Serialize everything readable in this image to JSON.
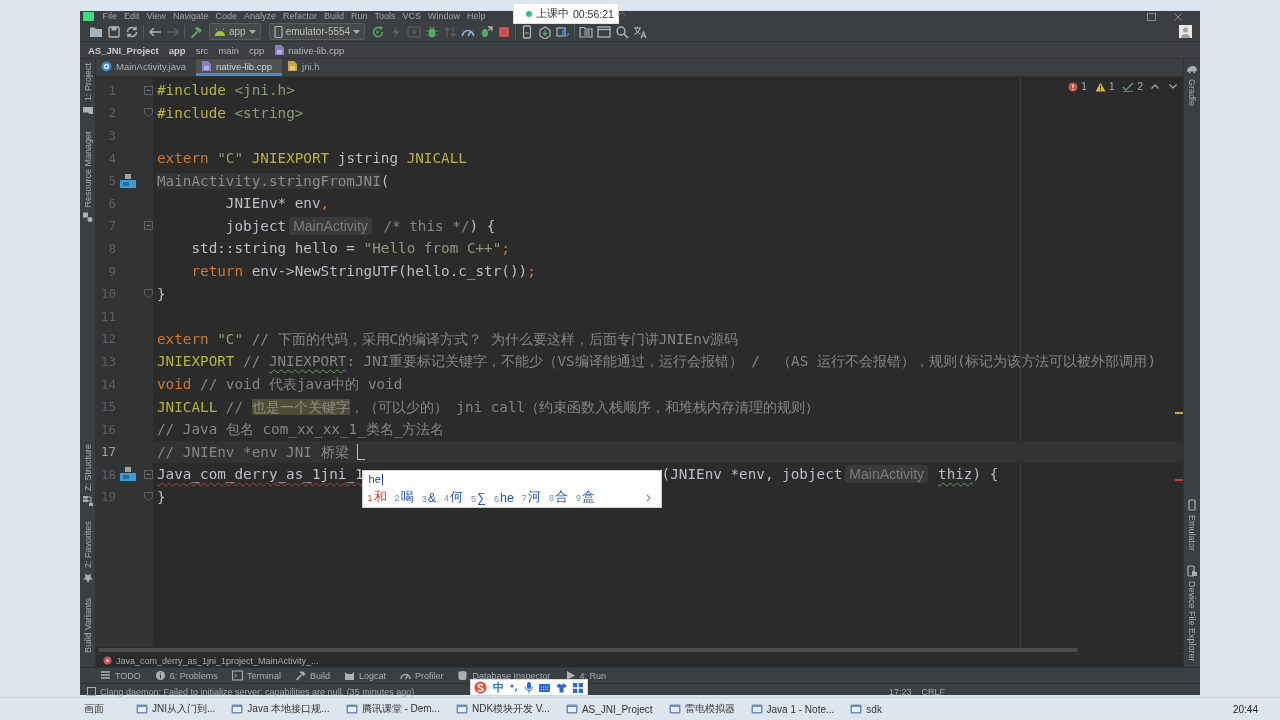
{
  "window": {
    "menu": [
      "File",
      "Edit",
      "View",
      "Navigate",
      "Code",
      "Analyze",
      "Refactor",
      "Build",
      "Run",
      "Tools",
      "VCS",
      "Window",
      "Help"
    ]
  },
  "recording_badge": {
    "label": "上课中",
    "time": "00:56:21"
  },
  "toolbar": {
    "groups": [
      [
        {
          "kind": "open",
          "disabled": false
        },
        {
          "kind": "save",
          "disabled": false
        },
        {
          "kind": "sync",
          "disabled": false
        }
      ],
      [
        {
          "kind": "back",
          "disabled": false
        },
        {
          "kind": "forward",
          "disabled": true
        }
      ],
      [
        {
          "kind": "build",
          "disabled": false
        },
        {
          "kind": "run_config",
          "label": "app"
        },
        {
          "kind": "device",
          "label": "emulator-5554"
        },
        {
          "kind": "rerun",
          "disabled": false
        },
        {
          "kind": "apply_changes",
          "disabled": true
        },
        {
          "kind": "apply_code",
          "disabled": true
        },
        {
          "kind": "debug",
          "disabled": false
        },
        {
          "kind": "attach",
          "disabled": true
        },
        {
          "kind": "profile",
          "disabled": false
        },
        {
          "kind": "attach_debugger",
          "disabled": false
        },
        {
          "kind": "stop",
          "disabled": false
        }
      ],
      [
        {
          "kind": "avd",
          "disabled": false
        },
        {
          "kind": "sdk",
          "disabled": false
        },
        {
          "kind": "gradle_sync",
          "disabled": false
        }
      ],
      [
        {
          "kind": "structure",
          "disabled": false
        },
        {
          "kind": "window",
          "disabled": false
        },
        {
          "kind": "search",
          "disabled": false
        },
        {
          "kind": "translate",
          "disabled": false
        }
      ]
    ]
  },
  "nav_bar": {
    "crumbs": [
      {
        "label": "AS_JNI_Project",
        "kind": "project"
      },
      {
        "label": "app",
        "kind": "module"
      },
      {
        "label": "src",
        "kind": "dir"
      },
      {
        "label": "main",
        "kind": "dir"
      },
      {
        "label": "cpp",
        "kind": "dir"
      },
      {
        "label": "native-lib.cpp",
        "kind": "cpp"
      }
    ]
  },
  "tabs": [
    {
      "label": "MainActivity.java",
      "kind": "java",
      "selected": false
    },
    {
      "label": "native-lib.cpp",
      "kind": "cpp",
      "selected": true
    },
    {
      "label": "jni.h",
      "kind": "header",
      "selected": false
    }
  ],
  "left_tool_strip": {
    "top": [
      {
        "label": "1: Project",
        "kind": "project"
      },
      {
        "label": "Resource Manager",
        "kind": "resources"
      }
    ],
    "bottom": [
      {
        "label": "Z: Structure",
        "kind": "structure"
      },
      {
        "label": "2: Favorites",
        "kind": "favorites"
      },
      {
        "label": "Build Variants",
        "kind": "variants"
      }
    ]
  },
  "right_tool_strip": {
    "top": [
      {
        "label": "Gradle",
        "kind": "gradle"
      }
    ],
    "bottom": [
      {
        "label": "Emulator",
        "kind": "emulator"
      },
      {
        "label": "Device File Explorer",
        "kind": "device_files"
      }
    ]
  },
  "editor": {
    "inspections": [
      {
        "kind": "error",
        "count": "1"
      },
      {
        "kind": "warning",
        "count": "1"
      },
      {
        "kind": "typo",
        "count": "2"
      }
    ],
    "lines": [
      {
        "number": "1",
        "fold_start": true,
        "fold_end": false,
        "gutter_mark": false,
        "current": false,
        "segments": [
          {
            "kind": "directive",
            "text": "#include"
          },
          {
            "kind": "string",
            "text": " <jni.h>"
          }
        ]
      },
      {
        "number": "2",
        "fold_start": false,
        "fold_end": true,
        "gutter_mark": false,
        "current": false,
        "segments": [
          {
            "kind": "directive",
            "text": "#include"
          },
          {
            "kind": "string",
            "text": " <string>"
          }
        ]
      },
      {
        "number": "3",
        "fold_start": false,
        "fold_end": false,
        "gutter_mark": false,
        "current": false
      },
      {
        "number": "4",
        "fold_start": false,
        "fold_end": false,
        "gutter_mark": false,
        "current": false,
        "segments": [
          {
            "kind": "keyword",
            "text": "extern"
          },
          {
            "kind": "string",
            "text": " \"C\""
          },
          {
            "kind": "macro",
            "text": " JNIEXPORT"
          },
          {
            "kind": "text",
            "text": " jstring "
          },
          {
            "kind": "macro",
            "text": "JNICALL"
          }
        ]
      },
      {
        "number": "5",
        "fold_start": false,
        "fold_end": false,
        "gutter_mark": true,
        "current": false,
        "segments": [
          {
            "kind": "greyed",
            "text": "MainActivity.stringFromJNI"
          },
          {
            "kind": "text",
            "text": "("
          }
        ]
      },
      {
        "number": "6",
        "fold_start": false,
        "fold_end": false,
        "gutter_mark": false,
        "current": false,
        "segments": [
          {
            "kind": "text",
            "text": "        JNIEnv* env"
          },
          {
            "kind": "punct",
            "text": ","
          }
        ]
      },
      {
        "number": "7",
        "fold_start": true,
        "fold_end": false,
        "gutter_mark": false,
        "current": false,
        "segments": [
          {
            "kind": "text",
            "text": "        jobject"
          },
          {
            "kind": "hint",
            "text": "MainActivity"
          },
          {
            "kind": "comment",
            "text": " /* this */"
          },
          {
            "kind": "text",
            "text": ") {"
          }
        ]
      },
      {
        "number": "8",
        "fold_start": false,
        "fold_end": false,
        "gutter_mark": false,
        "current": false,
        "segments": [
          {
            "kind": "text",
            "text": "    std::string hello = "
          },
          {
            "kind": "string",
            "text": "\"Hello from C++\""
          },
          {
            "kind": "punct",
            "text": ";"
          }
        ]
      },
      {
        "number": "9",
        "fold_start": false,
        "fold_end": false,
        "gutter_mark": false,
        "current": false,
        "segments": [
          {
            "kind": "keyword",
            "text": "    return"
          },
          {
            "kind": "text",
            "text": " env->NewStringUTF(hello.c_str())"
          },
          {
            "kind": "punct",
            "text": ";"
          }
        ]
      },
      {
        "number": "10",
        "fold_start": false,
        "fold_end": true,
        "gutter_mark": false,
        "current": false,
        "segments": [
          {
            "kind": "text",
            "text": "}"
          }
        ]
      },
      {
        "number": "11",
        "fold_start": false,
        "fold_end": false,
        "gutter_mark": false,
        "current": false
      },
      {
        "number": "12",
        "fold_start": false,
        "fold_end": false,
        "gutter_mark": false,
        "current": false,
        "segments": [
          {
            "kind": "keyword",
            "text": "extern"
          },
          {
            "kind": "string",
            "text": " \"C\""
          },
          {
            "kind": "comment",
            "text": " // 下面的代码，采用C的编译方式？ 为什么要这样，后面专门讲JNIEnv源码"
          }
        ]
      },
      {
        "number": "13",
        "fold_start": false,
        "fold_end": false,
        "gutter_mark": false,
        "current": false,
        "segments": [
          {
            "kind": "macro",
            "text": "JNIEXPORT"
          },
          {
            "kind": "comment",
            "text": " // "
          },
          {
            "kind": "comment_typo",
            "text": "JNIEXPORT"
          },
          {
            "kind": "comment",
            "text": ": JNI重要标记关键字，不能少（VS编译能通过，运行会报错） /  （AS 运行不会报错），规则(标记为该方法可以被外部调用)"
          }
        ]
      },
      {
        "number": "14",
        "fold_start": false,
        "fold_end": false,
        "gutter_mark": false,
        "current": false,
        "segments": [
          {
            "kind": "keyword",
            "text": "void"
          },
          {
            "kind": "comment",
            "text": " // void 代表java中的 void"
          }
        ]
      },
      {
        "number": "15",
        "fold_start": false,
        "fold_end": false,
        "gutter_mark": false,
        "current": false,
        "segments": [
          {
            "kind": "macro",
            "text": "JNICALL"
          },
          {
            "kind": "comment",
            "text": " // "
          },
          {
            "kind": "highlight",
            "text": "也是一个关键字"
          },
          {
            "kind": "comment",
            "text": "，（可以少的） jni call（约束函数入栈顺序，和堆栈内存清理的规则）"
          }
        ]
      },
      {
        "number": "16",
        "fold_start": false,
        "fold_end": false,
        "gutter_mark": false,
        "current": false,
        "segments": [
          {
            "kind": "comment",
            "text": "// Java 包名 com_xx_xx_1_类名_方法名"
          }
        ]
      },
      {
        "number": "17",
        "fold_start": false,
        "fold_end": false,
        "gutter_mark": false,
        "current": true,
        "segments": [
          {
            "kind": "comment",
            "text": "// JNIEnv *env JNI 桥梁"
          }
        ]
      },
      {
        "number": "18",
        "fold_start": true,
        "fold_end": false,
        "gutter_mark": true,
        "current": false,
        "segments": [
          {
            "kind": "text_error",
            "text": "Java_com_derry_as_1jni_1"
          },
          {
            "kind": "ime_popup",
            "input": "he",
            "candidates": [
              {
                "number": "1",
                "text": "和",
                "selected": true
              },
              {
                "number": "2",
                "text": "喝",
                "selected": false
              },
              {
                "number": "3",
                "text": "&",
                "selected": false
              },
              {
                "number": "4",
                "text": "何",
                "selected": false
              },
              {
                "number": "5",
                "text": "∑",
                "selected": false
              },
              {
                "number": "6",
                "text": "he",
                "selected": false
              },
              {
                "number": "7",
                "text": "河",
                "selected": false
              },
              {
                "number": "8",
                "text": "合",
                "selected": false
              },
              {
                "number": "9",
                "text": "盒",
                "selected": false
              }
            ]
          },
          {
            "kind": "text",
            "text": "(JNIEnv *env, jobject"
          },
          {
            "kind": "hint",
            "text": "MainActivity"
          },
          {
            "kind": "text_typo",
            "text": "thiz"
          },
          {
            "kind": "text",
            "text": ") {"
          }
        ]
      },
      {
        "number": "19",
        "fold_start": false,
        "fold_end": true,
        "gutter_mark": false,
        "current": false,
        "segments": [
          {
            "kind": "text",
            "text": "}"
          }
        ]
      }
    ]
  },
  "editor_breadcrumb": "Java_com_derry_as_1jni_1project_MainActivity_...",
  "tool_windows": [
    {
      "label": "TODO",
      "kind": "todo"
    },
    {
      "label": "6: Problems",
      "kind": "problems"
    },
    {
      "label": "Terminal",
      "kind": "terminal"
    },
    {
      "label": "Build",
      "kind": "build"
    },
    {
      "label": "Logcat",
      "kind": "logcat"
    },
    {
      "label": "Profiler",
      "kind": "profiler"
    },
    {
      "label": "Database Inspector",
      "kind": "database"
    },
    {
      "label": "4: Run",
      "kind": "run"
    }
  ],
  "status_bar": {
    "message": "Clang daemon: Failed to initialize server: capabilities are null. (35 minutes ago)",
    "right": [
      "17:23",
      "CRLF"
    ]
  },
  "ime_toolbar": {
    "mode": "中"
  },
  "taskbar": {
    "start_label": "画面",
    "items": [
      {
        "label": "JNI从入门到..."
      },
      {
        "label": "Java 本地接口规..."
      },
      {
        "label": "腾讯课堂 - Dem..."
      },
      {
        "label": "NDK模块开发 V..."
      },
      {
        "label": "AS_JNI_Project"
      },
      {
        "label": "雷电模拟器"
      },
      {
        "label": "Java 1 - Note..."
      },
      {
        "label": "sdk"
      }
    ],
    "clock": "20:44"
  }
}
